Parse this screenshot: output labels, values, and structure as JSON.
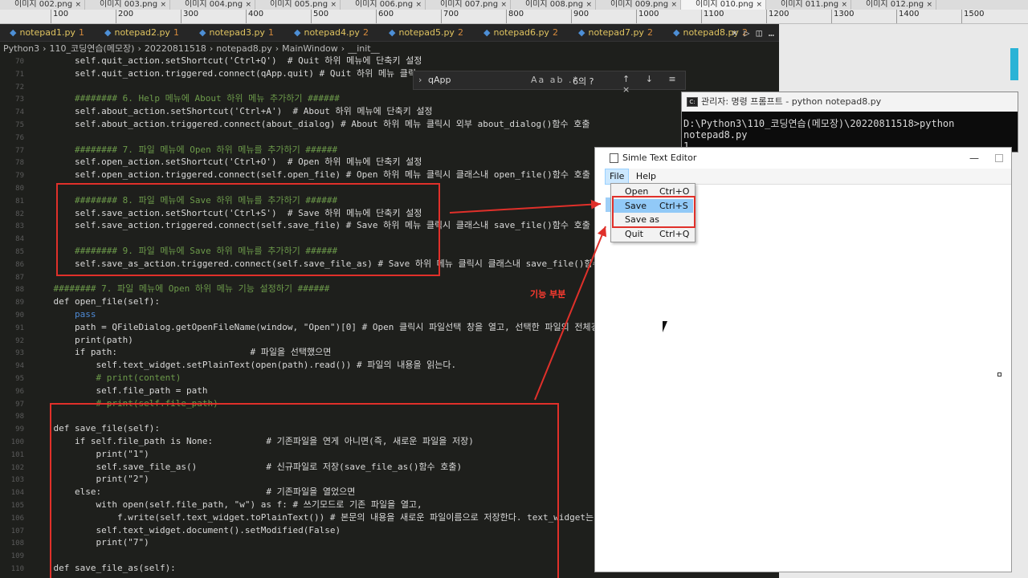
{
  "image_tabs": [
    {
      "label": "이미지 002.png"
    },
    {
      "label": "이미지 003.png"
    },
    {
      "label": "이미지 004.png"
    },
    {
      "label": "이미지 005.png"
    },
    {
      "label": "이미지 006.png"
    },
    {
      "label": "이미지 007.png"
    },
    {
      "label": "이미지 008.png"
    },
    {
      "label": "이미지 009.png"
    },
    {
      "label": "이미지 010.png"
    },
    {
      "label": "이미지 011.png"
    },
    {
      "label": "이미지 012.png"
    }
  ],
  "ruler_ticks": [
    "100",
    "200",
    "300",
    "400",
    "500",
    "600",
    "700",
    "800",
    "900",
    "1000",
    "1100",
    "1200",
    "1300",
    "1400",
    "1500"
  ],
  "editor": {
    "tabs": [
      {
        "label": "notepad1.py",
        "mod": "1"
      },
      {
        "label": "notepad2.py",
        "mod": "1"
      },
      {
        "label": "notepad3.py",
        "mod": "1"
      },
      {
        "label": "notepad4.py",
        "mod": "2"
      },
      {
        "label": "notepad5.py",
        "mod": "2"
      },
      {
        "label": "notepad6.py",
        "mod": "2"
      },
      {
        "label": "notepad7.py",
        "mod": "2"
      },
      {
        "label": "notepad8.py",
        "mod": "2"
      }
    ],
    "breadcrumb": [
      "Python3",
      "110_코딩연습(메모장)",
      "20220811518",
      "notepad8.py",
      "MainWindow",
      "__init__"
    ],
    "find": {
      "query": "qApp",
      "options": "Aa ab .*",
      "count": "6의 ?",
      "nav": "↑ ↓ ≡ ×"
    },
    "lines": [
      {
        "n": "70",
        "text": "        self.quit_action.setShortcut('Ctrl+Q')  # Quit 하위 메뉴에 단축키 설정",
        "cls": ""
      },
      {
        "n": "71",
        "text": "        self.quit_action.triggered.connect(qApp.quit) # Quit 하위 메뉴 클릭",
        "cls": ""
      },
      {
        "n": "72",
        "text": "",
        "cls": ""
      },
      {
        "n": "73",
        "text": "        ######## 6. Help 메뉴에 About 하위 메뉴 추가하기 ######",
        "cls": "cm"
      },
      {
        "n": "74",
        "text": "        self.about_action.setShortcut('Ctrl+A')  # About 하위 메뉴에 단축키 설정",
        "cls": ""
      },
      {
        "n": "75",
        "text": "        self.about_action.triggered.connect(about_dialog) # About 하위 메뉴 클릭시 외부 about_dialog()함수 호출",
        "cls": ""
      },
      {
        "n": "76",
        "text": "",
        "cls": ""
      },
      {
        "n": "77",
        "text": "        ######## 7. 파일 메뉴에 Open 하위 메뉴를 추가하기 ######",
        "cls": "cm"
      },
      {
        "n": "78",
        "text": "        self.open_action.setShortcut('Ctrl+O')  # Open 하위 메뉴에 단축키 설정",
        "cls": ""
      },
      {
        "n": "79",
        "text": "        self.open_action.triggered.connect(self.open_file) # Open 하위 메뉴 클릭시 클래스내 open_file()함수 호출",
        "cls": ""
      },
      {
        "n": "80",
        "text": "",
        "cls": ""
      },
      {
        "n": "81",
        "text": "        ######## 8. 파일 메뉴에 Save 하위 메뉴를 추가하기 ######",
        "cls": "cm"
      },
      {
        "n": "82",
        "text": "        self.save_action.setShortcut('Ctrl+S')  # Save 하위 메뉴에 단축키 설정",
        "cls": ""
      },
      {
        "n": "83",
        "text": "        self.save_action.triggered.connect(self.save_file) # Save 하위 메뉴 클릭시 클래스내 save_file()함수 호출",
        "cls": ""
      },
      {
        "n": "84",
        "text": "",
        "cls": ""
      },
      {
        "n": "85",
        "text": "        ######## 9. 파일 메뉴에 Save 하위 메뉴를 추가하기 ######",
        "cls": "cm"
      },
      {
        "n": "86",
        "text": "        self.save_as_action.triggered.connect(self.save_file_as) # Save 하위 메뉴 클릭시 클래스내 save_file()함수 호",
        "cls": ""
      },
      {
        "n": "87",
        "text": "",
        "cls": ""
      },
      {
        "n": "88",
        "text": "    ######## 7. 파일 메뉴에 Open 하위 메뉴 기능 설정하기 ######",
        "cls": "cm"
      },
      {
        "n": "89",
        "text": "    def open_file(self):",
        "cls": ""
      },
      {
        "n": "90",
        "text": "        pass",
        "cls": "kw"
      },
      {
        "n": "91",
        "text": "        path = QFileDialog.getOpenFileName(window, \"Open\")[0] # Open 클릭시 파일선택 창을 열고, 선택한 파일의 전체경로",
        "cls": ""
      },
      {
        "n": "92",
        "text": "        print(path)",
        "cls": ""
      },
      {
        "n": "93",
        "text": "        if path:                         # 파일을 선택했으면",
        "cls": ""
      },
      {
        "n": "94",
        "text": "            self.text_widget.setPlainText(open(path).read()) # 파일의 내용을 읽는다.",
        "cls": ""
      },
      {
        "n": "95",
        "text": "            # print(content)",
        "cls": "cm"
      },
      {
        "n": "96",
        "text": "            self.file_path = path",
        "cls": ""
      },
      {
        "n": "97",
        "text": "            # print(self.file_path)",
        "cls": "cm"
      },
      {
        "n": "98",
        "text": "",
        "cls": ""
      },
      {
        "n": "99",
        "text": "    def save_file(self):",
        "cls": ""
      },
      {
        "n": "100",
        "text": "        if self.file_path is None:          # 기존파일을 연게 아니면(즉, 새로운 파일을 저장)",
        "cls": ""
      },
      {
        "n": "101",
        "text": "            print(\"1\")",
        "cls": ""
      },
      {
        "n": "102",
        "text": "            self.save_file_as()             # 신규파일로 저장(save_file_as()함수 호출)",
        "cls": ""
      },
      {
        "n": "103",
        "text": "            print(\"2\")",
        "cls": ""
      },
      {
        "n": "104",
        "text": "        else:                               # 기존파일을 열었으면",
        "cls": ""
      },
      {
        "n": "105",
        "text": "            with open(self.file_path, \"w\") as f: # 쓰기모드로 기존 파일을 열고,",
        "cls": ""
      },
      {
        "n": "106",
        "text": "                f.write(self.text_widget.toPlainText()) # 본문의 내용을 새로운 파일이름으로 저장한다. text_widget는 Q",
        "cls": ""
      },
      {
        "n": "107",
        "text": "            self.text_widget.document().setModified(False)",
        "cls": ""
      },
      {
        "n": "108",
        "text": "            print(\"7\")",
        "cls": ""
      },
      {
        "n": "109",
        "text": "",
        "cls": ""
      },
      {
        "n": "110",
        "text": "    def save_file_as(self):",
        "cls": ""
      }
    ]
  },
  "annotation_label": "기능 부분",
  "cmd": {
    "title": "관리자: 명령 프롬프트 - python  notepad8.py",
    "lines": [
      "D:\\Python3\\110_코딩연습(메모장)\\20220811518>python notepad8.py",
      "1"
    ]
  },
  "ste": {
    "title": "Simle Text Editor",
    "menus": [
      "File",
      "Help"
    ],
    "file_menu": [
      {
        "label": "Open",
        "shortcut": "Ctrl+O"
      },
      {
        "label": "Save",
        "shortcut": "Ctrl+S"
      },
      {
        "label": "Save as",
        "shortcut": ""
      },
      {
        "label": "Quit",
        "shortcut": "Ctrl+Q"
      }
    ]
  },
  "colors": {
    "accent_red": "#e0302a",
    "menu_highlight": "#91c9f7"
  }
}
